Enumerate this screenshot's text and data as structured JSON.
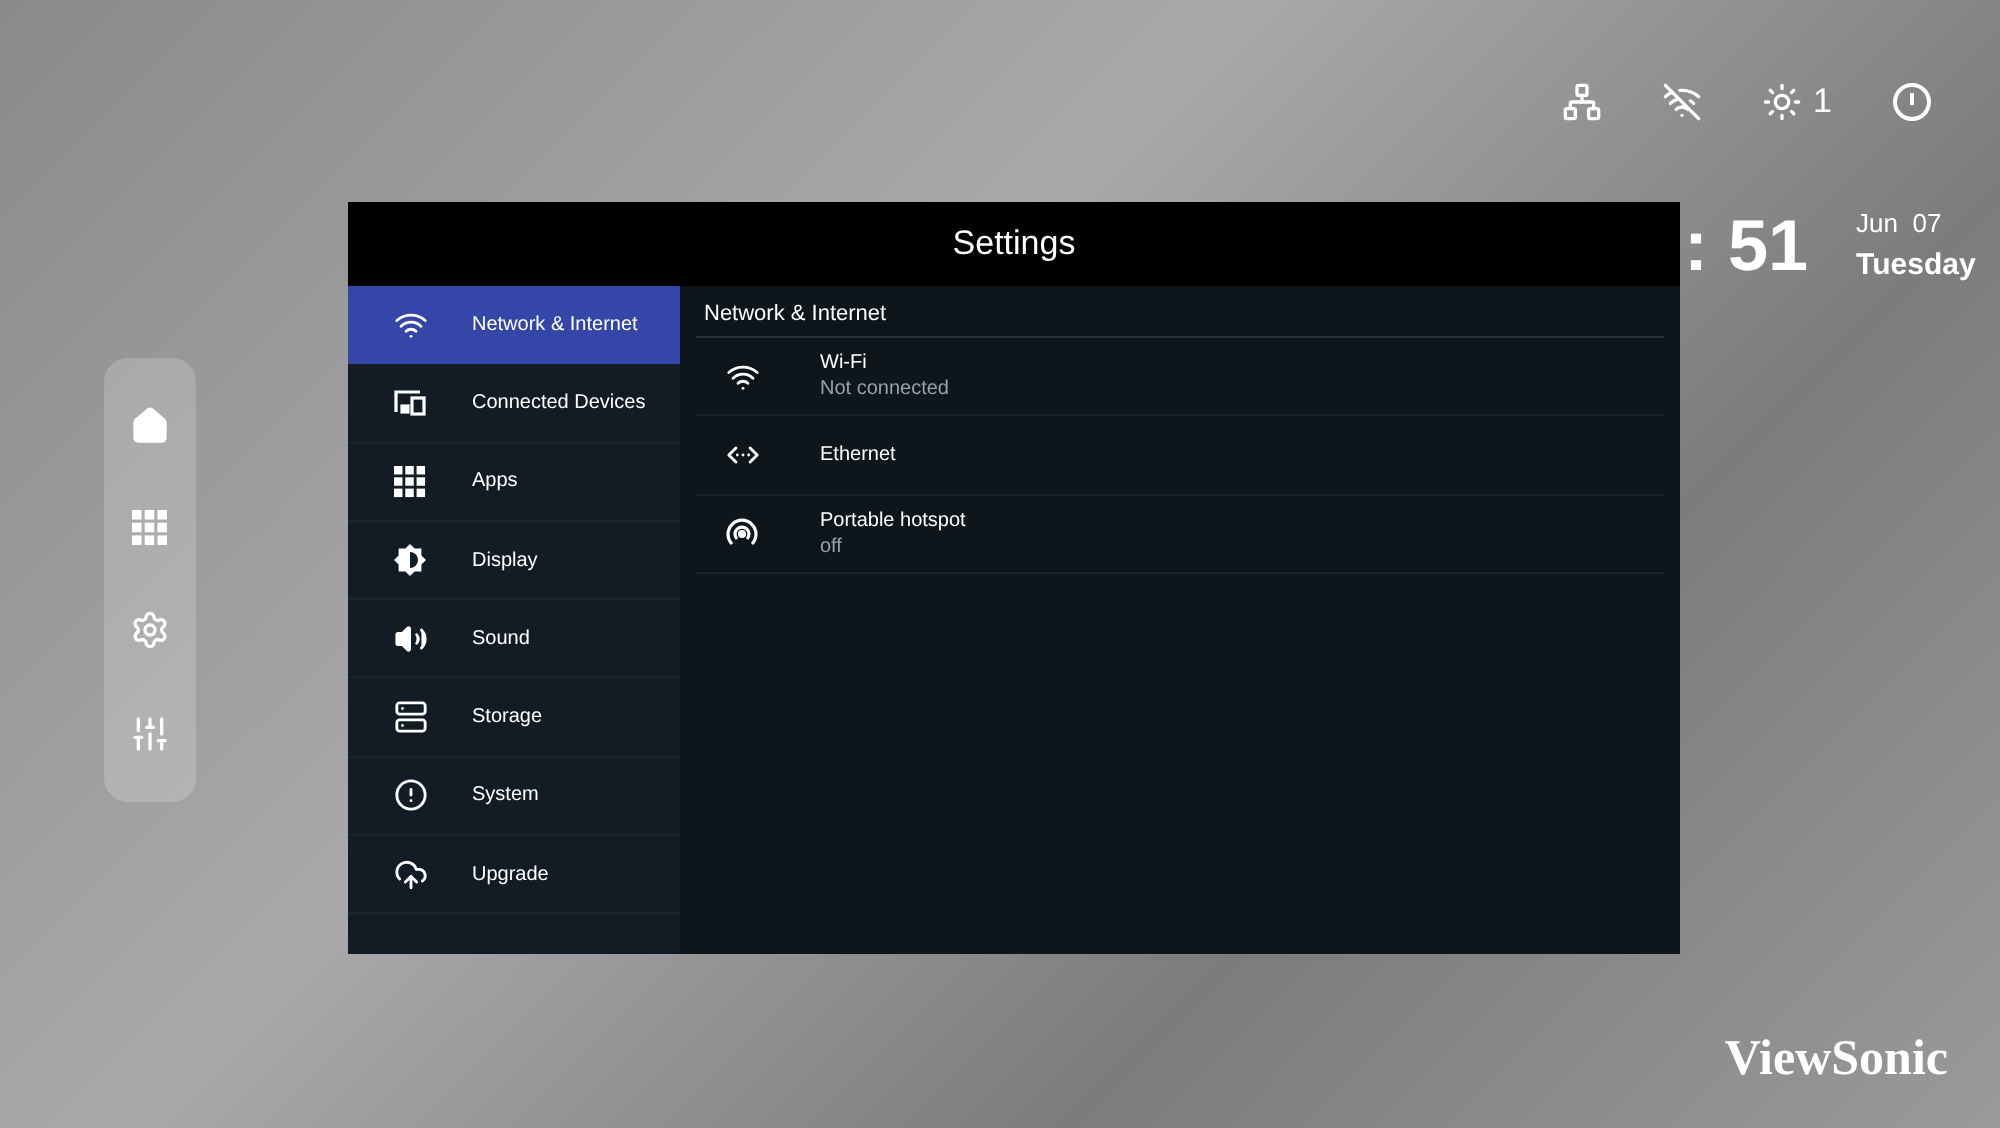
{
  "status_bar": {
    "brightness_value": "1"
  },
  "clock": {
    "time": ": 51",
    "date": "Jun  07",
    "weekday": "Tuesday"
  },
  "settings": {
    "title": "Settings",
    "sidebar": {
      "items": [
        {
          "label": "Network & Internet",
          "selected": true
        },
        {
          "label": "Connected Devices",
          "selected": false
        },
        {
          "label": "Apps",
          "selected": false
        },
        {
          "label": "Display",
          "selected": false
        },
        {
          "label": "Sound",
          "selected": false
        },
        {
          "label": "Storage",
          "selected": false
        },
        {
          "label": "System",
          "selected": false
        },
        {
          "label": "Upgrade",
          "selected": false
        }
      ]
    },
    "content": {
      "heading": "Network & Internet",
      "entries": [
        {
          "title": "Wi-Fi",
          "subtitle": "Not connected"
        },
        {
          "title": "Ethernet"
        },
        {
          "title": "Portable hotspot",
          "subtitle": "off"
        }
      ]
    }
  },
  "logo": {
    "text": "ViewSonic"
  }
}
